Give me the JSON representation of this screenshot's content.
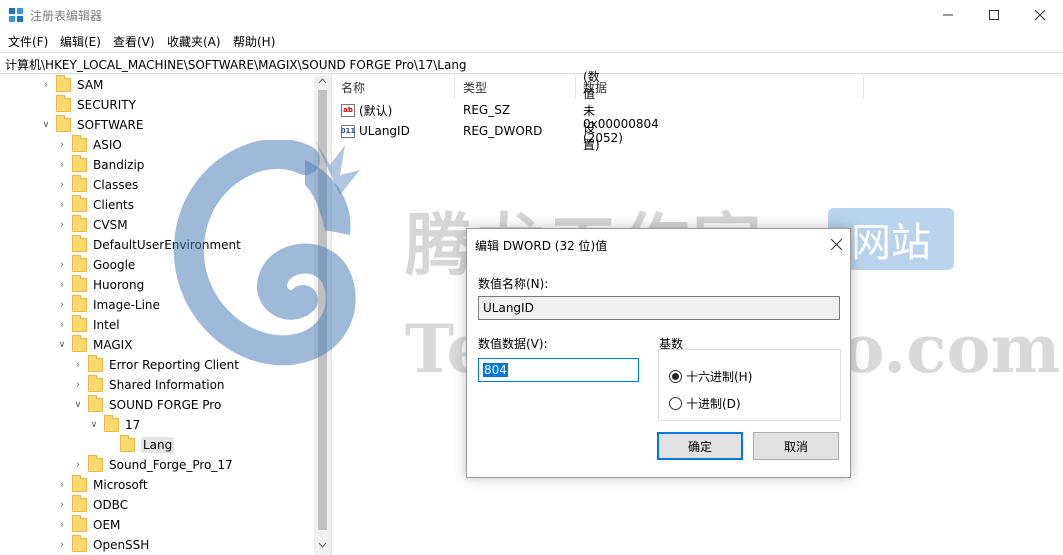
{
  "window": {
    "title": "注册表编辑器"
  },
  "menu": [
    {
      "label": "文件(F)"
    },
    {
      "label": "编辑(E)"
    },
    {
      "label": "查看(V)"
    },
    {
      "label": "收藏夹(A)"
    },
    {
      "label": "帮助(H)"
    }
  ],
  "address": {
    "path": "计算机\\HKEY_LOCAL_MACHINE\\SOFTWARE\\MAGIX\\SOUND FORGE Pro\\17\\Lang"
  },
  "tree": [
    {
      "label": "SAM",
      "level": 0,
      "expanded": false,
      "has_children": true
    },
    {
      "label": "SECURITY",
      "level": 0,
      "expanded": false,
      "has_children": false
    },
    {
      "label": "SOFTWARE",
      "level": 0,
      "expanded": true,
      "has_children": true
    },
    {
      "label": "ASIO",
      "level": 1,
      "expanded": false,
      "has_children": true
    },
    {
      "label": "Bandizip",
      "level": 1,
      "expanded": false,
      "has_children": true
    },
    {
      "label": "Classes",
      "level": 1,
      "expanded": false,
      "has_children": true
    },
    {
      "label": "Clients",
      "level": 1,
      "expanded": false,
      "has_children": true
    },
    {
      "label": "CVSM",
      "level": 1,
      "expanded": false,
      "has_children": true
    },
    {
      "label": "DefaultUserEnvironment",
      "level": 1,
      "expanded": false,
      "has_children": false
    },
    {
      "label": "Google",
      "level": 1,
      "expanded": false,
      "has_children": true
    },
    {
      "label": "Huorong",
      "level": 1,
      "expanded": false,
      "has_children": true
    },
    {
      "label": "Image-Line",
      "level": 1,
      "expanded": false,
      "has_children": true
    },
    {
      "label": "Intel",
      "level": 1,
      "expanded": false,
      "has_children": true
    },
    {
      "label": "MAGIX",
      "level": 1,
      "expanded": true,
      "has_children": true
    },
    {
      "label": "Error Reporting Client",
      "level": 2,
      "expanded": false,
      "has_children": true
    },
    {
      "label": "Shared Information",
      "level": 2,
      "expanded": false,
      "has_children": true
    },
    {
      "label": "SOUND FORGE Pro",
      "level": 2,
      "expanded": true,
      "has_children": true
    },
    {
      "label": "17",
      "level": 3,
      "expanded": true,
      "has_children": true
    },
    {
      "label": "Lang",
      "level": 4,
      "expanded": false,
      "has_children": false,
      "selected": true
    },
    {
      "label": "Sound_Forge_Pro_17",
      "level": 2,
      "expanded": false,
      "has_children": true
    },
    {
      "label": "Microsoft",
      "level": 1,
      "expanded": false,
      "has_children": true
    },
    {
      "label": "ODBC",
      "level": 1,
      "expanded": false,
      "has_children": true
    },
    {
      "label": "OEM",
      "level": 1,
      "expanded": false,
      "has_children": true
    },
    {
      "label": "OpenSSH",
      "level": 1,
      "expanded": false,
      "has_children": true
    }
  ],
  "list": {
    "headers": {
      "name": "名称",
      "type": "类型",
      "data": "数据"
    },
    "rows": [
      {
        "icon": "string-value-icon",
        "name": "(默认)",
        "type": "REG_SZ",
        "data": "(数值未设置)"
      },
      {
        "icon": "dword-value-icon",
        "name": "ULangID",
        "type": "REG_DWORD",
        "data": "0x00000804 (2052)"
      }
    ]
  },
  "watermark": {
    "cn": "腾龙工作室",
    "site": "网站",
    "en": "Tenlonstudio.com"
  },
  "dialog": {
    "title": "编辑 DWORD (32 位)值",
    "name_label": "数值名称(N):",
    "name_value": "ULangID",
    "data_label": "数值数据(V):",
    "data_value": "804",
    "base_label": "基数",
    "radios": [
      {
        "label": "十六进制(H)",
        "checked": true
      },
      {
        "label": "十进制(D)",
        "checked": false
      }
    ],
    "ok_label": "确定",
    "cancel_label": "取消"
  }
}
